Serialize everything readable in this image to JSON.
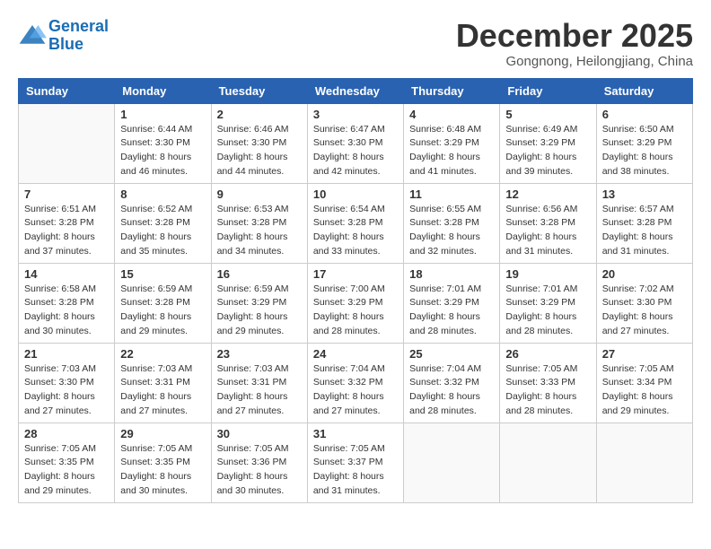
{
  "logo": {
    "general": "General",
    "blue": "Blue"
  },
  "title": "December 2025",
  "subtitle": "Gongnong, Heilongjiang, China",
  "weekdays": [
    "Sunday",
    "Monday",
    "Tuesday",
    "Wednesday",
    "Thursday",
    "Friday",
    "Saturday"
  ],
  "weeks": [
    [
      {
        "day": "",
        "info": ""
      },
      {
        "day": "1",
        "info": "Sunrise: 6:44 AM\nSunset: 3:30 PM\nDaylight: 8 hours\nand 46 minutes."
      },
      {
        "day": "2",
        "info": "Sunrise: 6:46 AM\nSunset: 3:30 PM\nDaylight: 8 hours\nand 44 minutes."
      },
      {
        "day": "3",
        "info": "Sunrise: 6:47 AM\nSunset: 3:30 PM\nDaylight: 8 hours\nand 42 minutes."
      },
      {
        "day": "4",
        "info": "Sunrise: 6:48 AM\nSunset: 3:29 PM\nDaylight: 8 hours\nand 41 minutes."
      },
      {
        "day": "5",
        "info": "Sunrise: 6:49 AM\nSunset: 3:29 PM\nDaylight: 8 hours\nand 39 minutes."
      },
      {
        "day": "6",
        "info": "Sunrise: 6:50 AM\nSunset: 3:29 PM\nDaylight: 8 hours\nand 38 minutes."
      }
    ],
    [
      {
        "day": "7",
        "info": "Sunrise: 6:51 AM\nSunset: 3:28 PM\nDaylight: 8 hours\nand 37 minutes."
      },
      {
        "day": "8",
        "info": "Sunrise: 6:52 AM\nSunset: 3:28 PM\nDaylight: 8 hours\nand 35 minutes."
      },
      {
        "day": "9",
        "info": "Sunrise: 6:53 AM\nSunset: 3:28 PM\nDaylight: 8 hours\nand 34 minutes."
      },
      {
        "day": "10",
        "info": "Sunrise: 6:54 AM\nSunset: 3:28 PM\nDaylight: 8 hours\nand 33 minutes."
      },
      {
        "day": "11",
        "info": "Sunrise: 6:55 AM\nSunset: 3:28 PM\nDaylight: 8 hours\nand 32 minutes."
      },
      {
        "day": "12",
        "info": "Sunrise: 6:56 AM\nSunset: 3:28 PM\nDaylight: 8 hours\nand 31 minutes."
      },
      {
        "day": "13",
        "info": "Sunrise: 6:57 AM\nSunset: 3:28 PM\nDaylight: 8 hours\nand 31 minutes."
      }
    ],
    [
      {
        "day": "14",
        "info": "Sunrise: 6:58 AM\nSunset: 3:28 PM\nDaylight: 8 hours\nand 30 minutes."
      },
      {
        "day": "15",
        "info": "Sunrise: 6:59 AM\nSunset: 3:28 PM\nDaylight: 8 hours\nand 29 minutes."
      },
      {
        "day": "16",
        "info": "Sunrise: 6:59 AM\nSunset: 3:29 PM\nDaylight: 8 hours\nand 29 minutes."
      },
      {
        "day": "17",
        "info": "Sunrise: 7:00 AM\nSunset: 3:29 PM\nDaylight: 8 hours\nand 28 minutes."
      },
      {
        "day": "18",
        "info": "Sunrise: 7:01 AM\nSunset: 3:29 PM\nDaylight: 8 hours\nand 28 minutes."
      },
      {
        "day": "19",
        "info": "Sunrise: 7:01 AM\nSunset: 3:29 PM\nDaylight: 8 hours\nand 28 minutes."
      },
      {
        "day": "20",
        "info": "Sunrise: 7:02 AM\nSunset: 3:30 PM\nDaylight: 8 hours\nand 27 minutes."
      }
    ],
    [
      {
        "day": "21",
        "info": "Sunrise: 7:03 AM\nSunset: 3:30 PM\nDaylight: 8 hours\nand 27 minutes."
      },
      {
        "day": "22",
        "info": "Sunrise: 7:03 AM\nSunset: 3:31 PM\nDaylight: 8 hours\nand 27 minutes."
      },
      {
        "day": "23",
        "info": "Sunrise: 7:03 AM\nSunset: 3:31 PM\nDaylight: 8 hours\nand 27 minutes."
      },
      {
        "day": "24",
        "info": "Sunrise: 7:04 AM\nSunset: 3:32 PM\nDaylight: 8 hours\nand 27 minutes."
      },
      {
        "day": "25",
        "info": "Sunrise: 7:04 AM\nSunset: 3:32 PM\nDaylight: 8 hours\nand 28 minutes."
      },
      {
        "day": "26",
        "info": "Sunrise: 7:05 AM\nSunset: 3:33 PM\nDaylight: 8 hours\nand 28 minutes."
      },
      {
        "day": "27",
        "info": "Sunrise: 7:05 AM\nSunset: 3:34 PM\nDaylight: 8 hours\nand 29 minutes."
      }
    ],
    [
      {
        "day": "28",
        "info": "Sunrise: 7:05 AM\nSunset: 3:35 PM\nDaylight: 8 hours\nand 29 minutes."
      },
      {
        "day": "29",
        "info": "Sunrise: 7:05 AM\nSunset: 3:35 PM\nDaylight: 8 hours\nand 30 minutes."
      },
      {
        "day": "30",
        "info": "Sunrise: 7:05 AM\nSunset: 3:36 PM\nDaylight: 8 hours\nand 30 minutes."
      },
      {
        "day": "31",
        "info": "Sunrise: 7:05 AM\nSunset: 3:37 PM\nDaylight: 8 hours\nand 31 minutes."
      },
      {
        "day": "",
        "info": ""
      },
      {
        "day": "",
        "info": ""
      },
      {
        "day": "",
        "info": ""
      }
    ]
  ]
}
